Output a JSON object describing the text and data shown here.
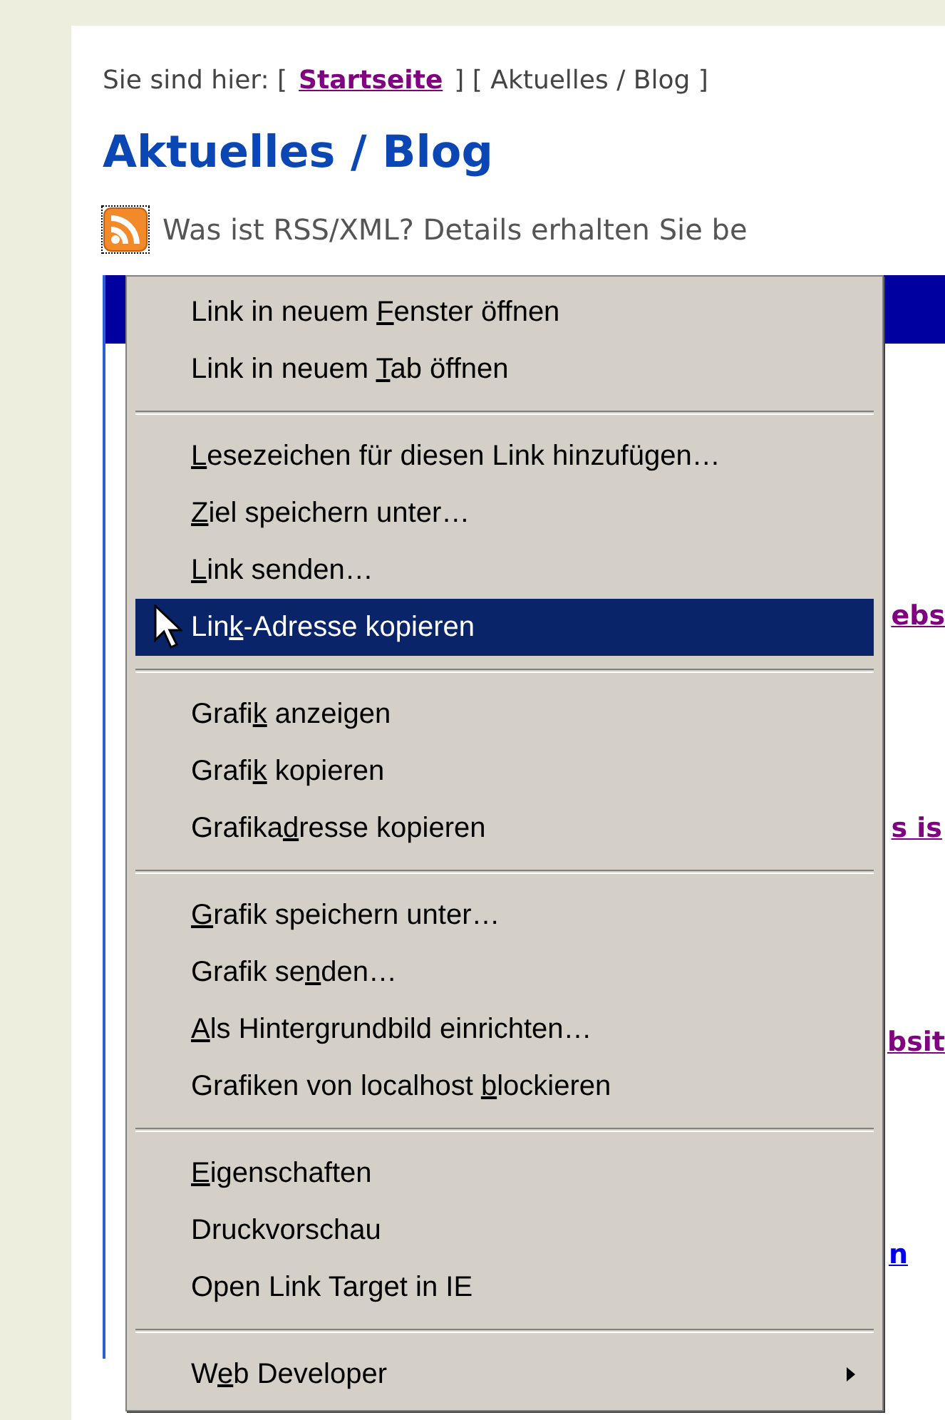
{
  "breadcrumb": {
    "prefix": "Sie sind hier: [",
    "home_link": "Startseite",
    "rest": "] [ Aktuelles / Blog ]"
  },
  "heading": "Aktuelles / Blog",
  "rss_note": "Was ist RSS/XML? Details erhalten Sie be",
  "links": [
    {
      "text": "ebs",
      "visited": true
    },
    {
      "text": "s is",
      "visited": true
    },
    {
      "text": "bsit",
      "visited": true
    },
    {
      "text": "n",
      "visited": false
    }
  ],
  "context_menu": {
    "groups": [
      [
        {
          "before": "Link in neuem ",
          "key": "F",
          "after": "enster öffnen",
          "selected": false,
          "submenu": false
        },
        {
          "before": "Link in neuem ",
          "key": "T",
          "after": "ab öffnen",
          "selected": false,
          "submenu": false
        }
      ],
      [
        {
          "key": "L",
          "after": "esezeichen für diesen Link hinzufügen…",
          "selected": false,
          "submenu": false
        },
        {
          "key": "Z",
          "after": "iel speichern unter…",
          "selected": false,
          "submenu": false
        },
        {
          "key": "L",
          "after": "ink senden…",
          "selected": false,
          "submenu": false
        },
        {
          "before": "Lin",
          "key": "k",
          "after": "-Adresse kopieren",
          "selected": true,
          "submenu": false
        }
      ],
      [
        {
          "before": "Grafi",
          "key": "k",
          "after": " anzeigen",
          "selected": false,
          "submenu": false
        },
        {
          "before": "Grafi",
          "key": "k",
          "after": " kopieren",
          "selected": false,
          "submenu": false
        },
        {
          "before": "Grafika",
          "key": "d",
          "after": "resse kopieren",
          "selected": false,
          "submenu": false
        }
      ],
      [
        {
          "key": "G",
          "after": "rafik speichern unter…",
          "selected": false,
          "submenu": false
        },
        {
          "before": "Grafik se",
          "key": "n",
          "after": "den…",
          "selected": false,
          "submenu": false
        },
        {
          "key": "A",
          "after": "ls Hintergrundbild einrichten…",
          "selected": false,
          "submenu": false
        },
        {
          "before": "Grafiken von localhost ",
          "key": "b",
          "after": "lockieren",
          "selected": false,
          "submenu": false
        }
      ],
      [
        {
          "key": "E",
          "after": "igenschaften",
          "selected": false,
          "submenu": false
        },
        {
          "before": "Druckvorschau",
          "selected": false,
          "submenu": false
        },
        {
          "before": "Open Link Target in IE",
          "selected": false,
          "submenu": false
        }
      ],
      [
        {
          "before": "W",
          "key": "e",
          "after": "b Developer",
          "selected": false,
          "submenu": true
        }
      ]
    ]
  }
}
